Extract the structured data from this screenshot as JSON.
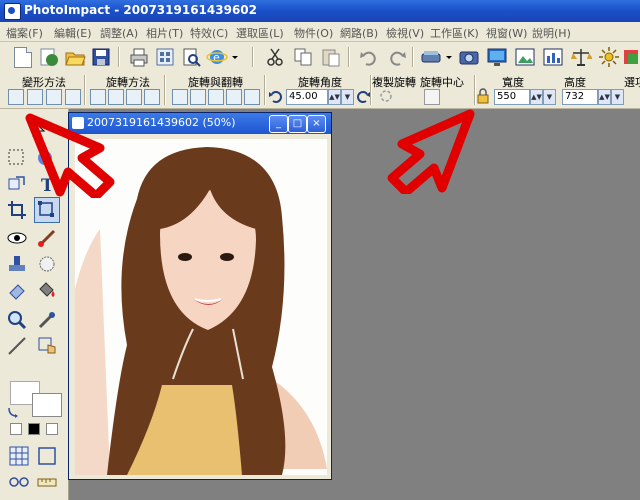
{
  "window": {
    "title": "PhotoImpact - 2007319161439602"
  },
  "menu": [
    "檔案(F)",
    "編輯(E)",
    "調整(A)",
    "相片(T)",
    "特效(C)",
    "選取區(L)",
    "物件(O)",
    "網路(B)",
    "檢視(V)",
    "工作區(K)",
    "視窗(W)",
    "說明(H)"
  ],
  "attr_toolbar": {
    "transform_method": "變形方法",
    "rotate_method": "旋轉方法",
    "rotate_flip": "旋轉與翻轉",
    "rotate_angle": "旋轉角度",
    "angle_value": "45.00",
    "duplicate_rotate": "複製旋轉",
    "rotate_center": "旋轉中心",
    "width_label": "寬度",
    "width_value": "550",
    "height_label": "高度",
    "height_value": "732",
    "select_label": "選項"
  },
  "document": {
    "title": "2007319161439602 (50%)",
    "min": "_",
    "max": "□",
    "close": "×"
  },
  "colors": {
    "title_blue": "#1a4fc8",
    "annotation_red": "#e00000",
    "workspace": "#808080"
  }
}
